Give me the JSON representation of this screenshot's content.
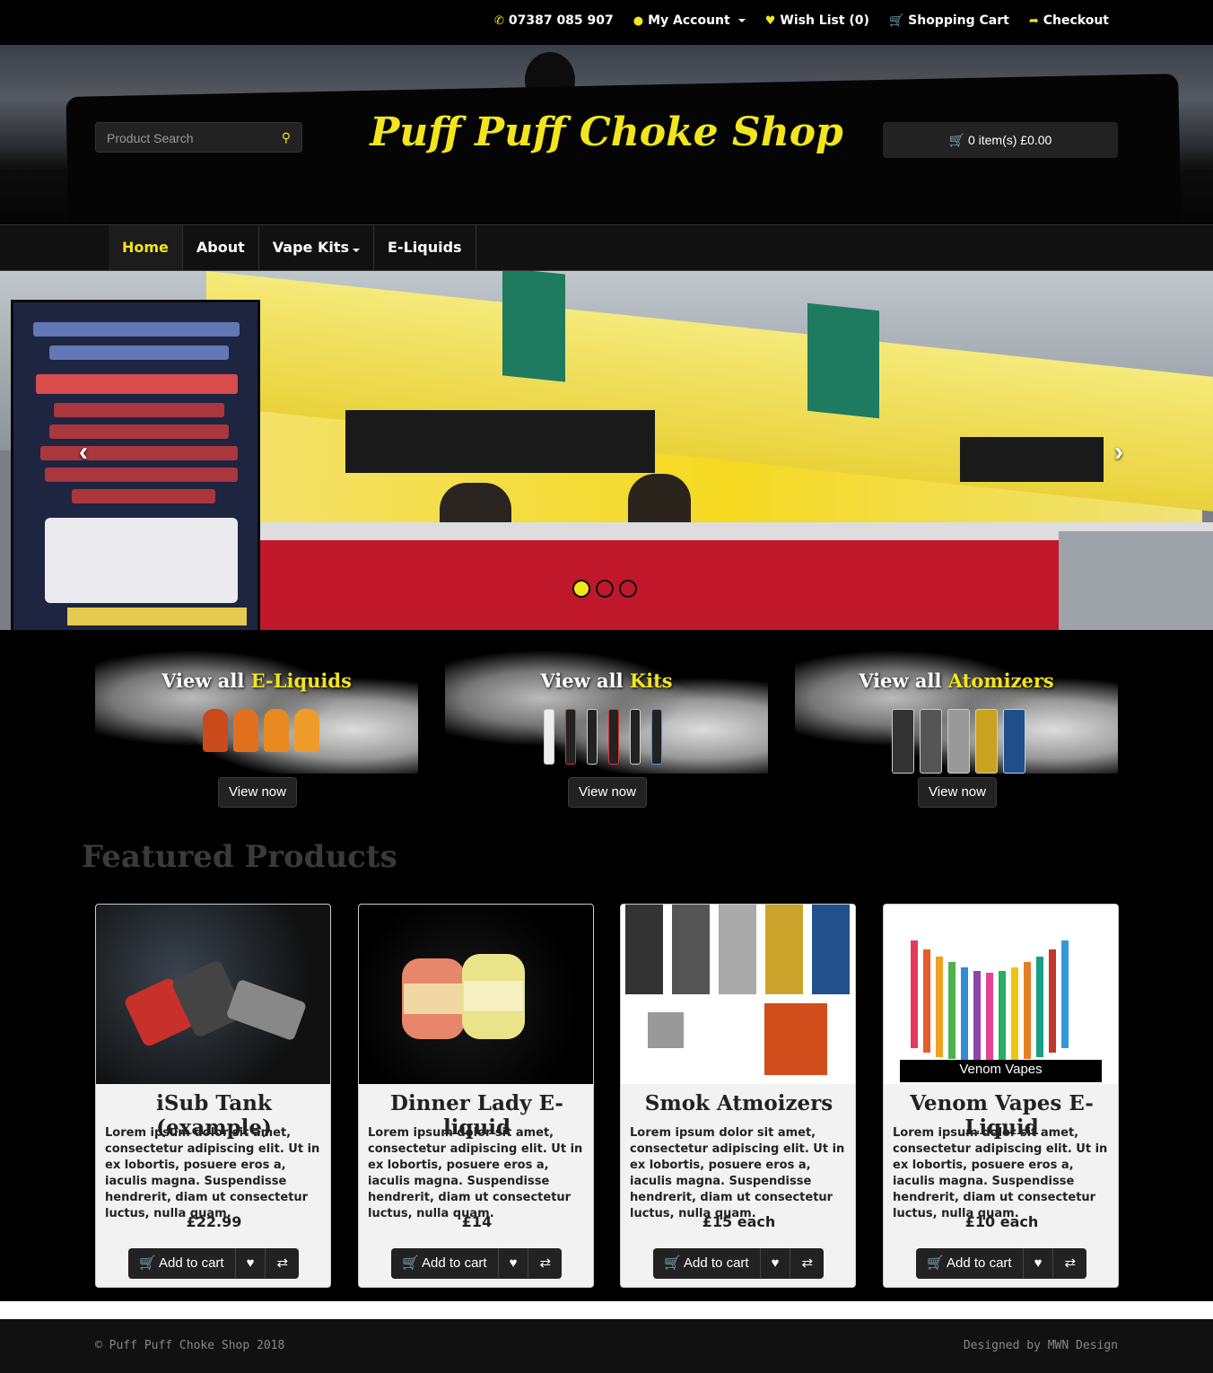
{
  "topbar": {
    "phone": "07387 085 907",
    "my_account": "My Account",
    "wish_list": "Wish List (0)",
    "shopping_cart": "Shopping Cart",
    "checkout": "Checkout"
  },
  "header": {
    "logo": "Puff Puff Choke Shop",
    "search_placeholder": "Product Search",
    "cart": "0 item(s) £0.00"
  },
  "nav": {
    "items": [
      {
        "label": "Home"
      },
      {
        "label": "About"
      },
      {
        "label": "Vape Kits"
      },
      {
        "label": "E-Liquids"
      }
    ]
  },
  "slider": {
    "active_slide": 1,
    "slide_count": 3
  },
  "categories": [
    {
      "prefix": "View all",
      "name": "E-Liquids",
      "button": "View now"
    },
    {
      "prefix": "View all",
      "name": "Kits",
      "button": "View now"
    },
    {
      "prefix": "View all",
      "name": "Atomizers",
      "button": "View now"
    }
  ],
  "featured": {
    "title": "Featured Products",
    "products": [
      {
        "name": "iSub Tank (example)",
        "desc": "Lorem ipsum dolor sit amet, consectetur adipiscing elit. Ut in ex lobortis, posuere eros a, iaculis magna. Suspendisse hendrerit, diam ut consectetur luctus, nulla quam.",
        "price": "£22.99",
        "add_to_cart": "Add to cart"
      },
      {
        "name": "Dinner Lady E-liquid",
        "desc": "Lorem ipsum dolor sit amet, consectetur adipiscing elit. Ut in ex lobortis, posuere eros a, iaculis magna. Suspendisse hendrerit, diam ut consectetur luctus, nulla quam.",
        "price": "£14",
        "add_to_cart": "Add to cart"
      },
      {
        "name": "Smok Atmoizers",
        "desc": "Lorem ipsum dolor sit amet, consectetur adipiscing elit. Ut in ex lobortis, posuere eros a, iaculis magna. Suspendisse hendrerit, diam ut consectetur luctus, nulla quam.",
        "price": "£15 each",
        "add_to_cart": "Add to cart"
      },
      {
        "name": "Venom Vapes E-Liquid",
        "desc": "Lorem ipsum dolor sit amet, consectetur adipiscing elit. Ut in ex lobortis, posuere eros a, iaculis magna. Suspendisse hendrerit, diam ut consectetur luctus, nulla quam.",
        "price": "£10 each",
        "add_to_cart": "Add to cart",
        "image_caption": "Venom Vapes"
      }
    ]
  },
  "footer": {
    "copyright": "© Puff Puff Choke Shop 2018",
    "credit": "Designed by MWN Design"
  },
  "colors": {
    "accent": "#f2e51d",
    "background": "#000000",
    "card": "#f2f2f2"
  }
}
